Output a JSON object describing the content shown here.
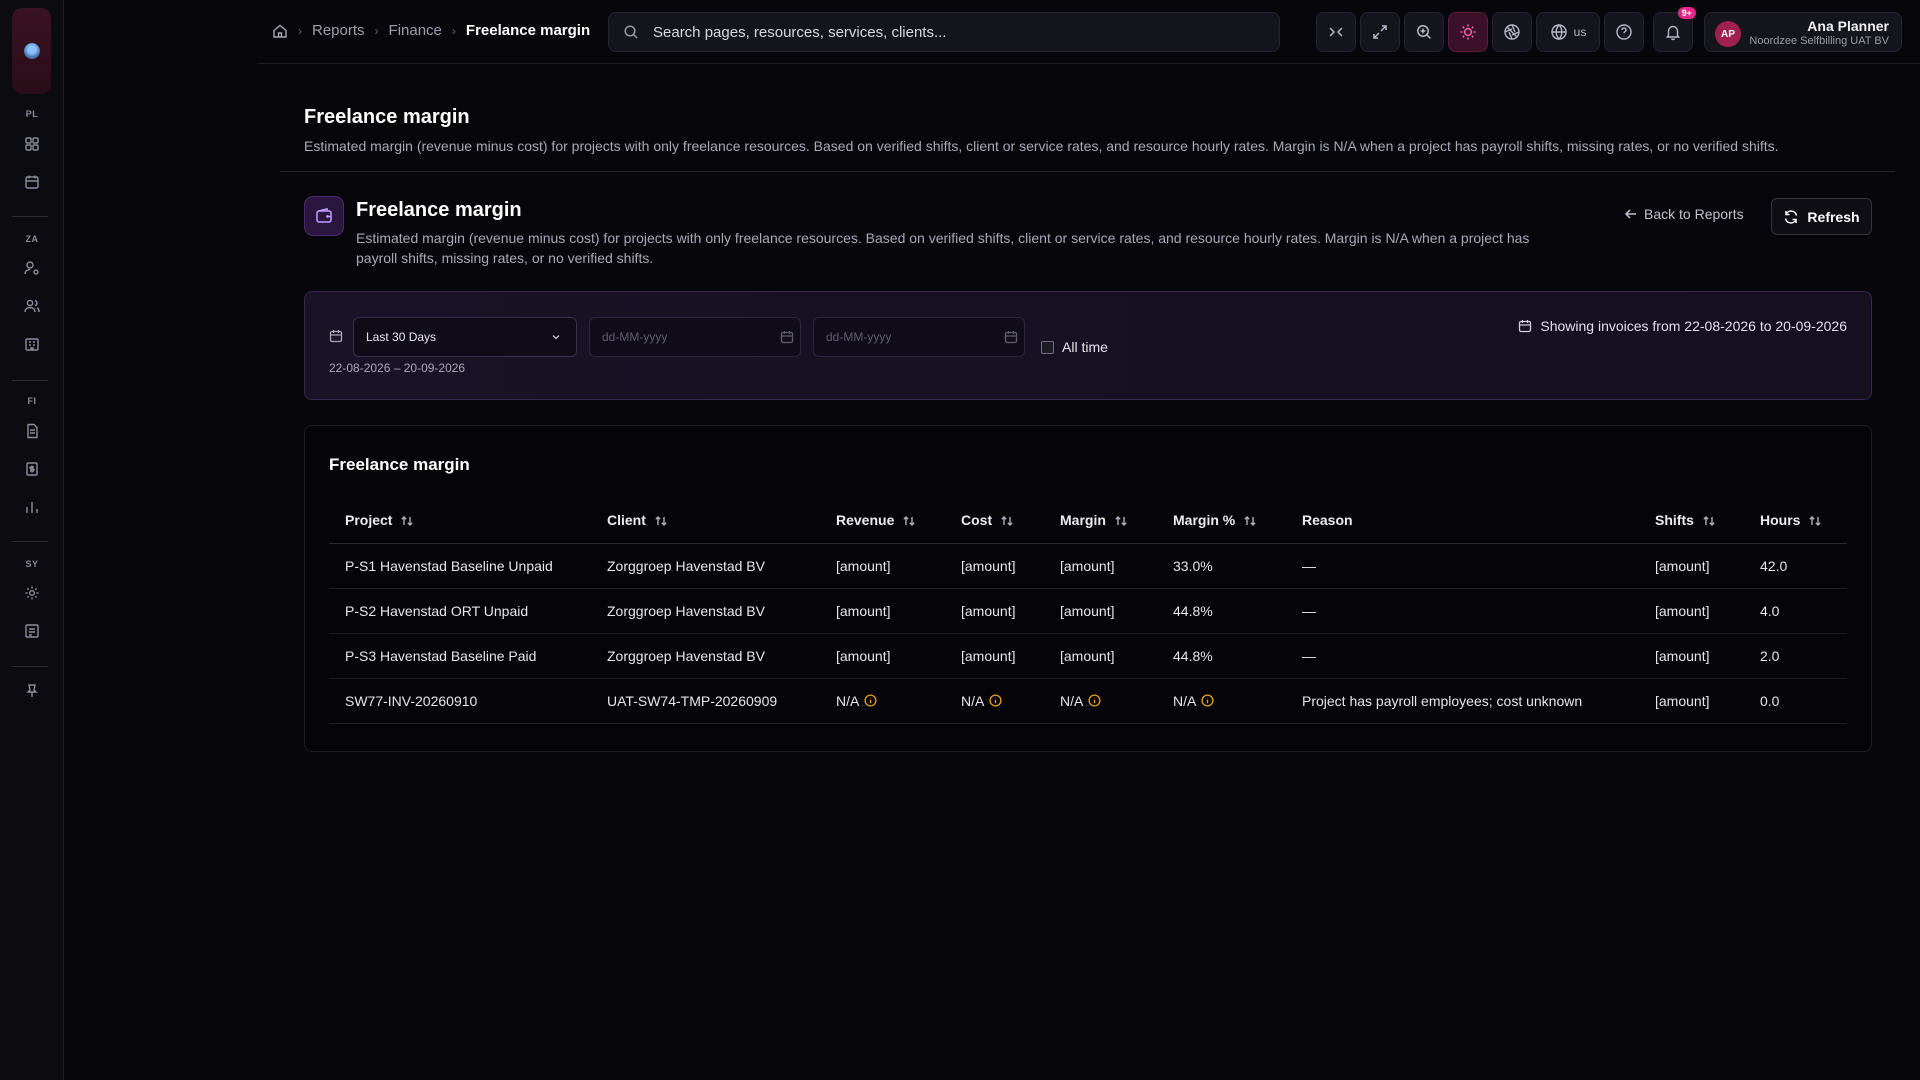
{
  "sidebar": {
    "sections": [
      "PL",
      "ZA",
      "FI",
      "SY"
    ],
    "icons": [
      "dashboard-icon",
      "calendar-icon",
      "user-gear-icon",
      "users-icon",
      "building-icon",
      "document-icon",
      "invoice-icon",
      "bar-chart-icon",
      "settings-icon",
      "receipt-icon",
      "pin-icon"
    ]
  },
  "breadcrumb": {
    "items": [
      "Reports",
      "Finance"
    ],
    "current": "Freelance margin"
  },
  "search": {
    "placeholder": "Search pages, resources, services, clients..."
  },
  "toolbar": {
    "locale": "us",
    "notifications_badge": "9+",
    "active_color": "#ff5fb0"
  },
  "user": {
    "initials": "AP",
    "name": "Ana Planner",
    "org": "Noordzee Selfbilling UAT BV"
  },
  "page": {
    "title": "Freelance margin",
    "description": "Estimated margin (revenue minus cost) for projects with only freelance resources. Based on verified shifts, client or service rates, and resource hourly rates. Margin is N/A when a project has payroll shifts, missing rates, or no verified shifts."
  },
  "card": {
    "title": "Freelance margin",
    "description": "Estimated margin (revenue minus cost) for projects with only freelance resources. Based on verified shifts, client or service rates, and resource hourly rates. Margin is N/A when a project has payroll shifts, missing rates, or no verified shifts.",
    "back_label": "Back to Reports",
    "refresh_label": "Refresh",
    "accent": "#c79bff"
  },
  "filter": {
    "period_selected": "Last 30 Days",
    "from_placeholder": "dd-MM-yyyy",
    "to_placeholder": "dd-MM-yyyy",
    "all_time_label": "All time",
    "all_time_checked": false,
    "range_text": "22-08-2026 – 20-09-2026",
    "showing_text": "Showing invoices from 22-08-2026 to 20-09-2026"
  },
  "table": {
    "title": "Freelance margin",
    "columns": [
      "Project",
      "Client",
      "Revenue",
      "Cost",
      "Margin",
      "Margin %",
      "Reason",
      "Shifts",
      "Hours"
    ],
    "sortable": [
      true,
      true,
      true,
      true,
      true,
      true,
      false,
      true,
      true
    ],
    "rows": [
      {
        "project": "P-S1 Havenstad Baseline Unpaid",
        "client": "Zorggroep Havenstad BV",
        "revenue": "[amount]",
        "cost": "[amount]",
        "margin": "[amount]",
        "margin_pct": "33.0%",
        "reason": "—",
        "shifts": "[amount]",
        "hours": "42.0"
      },
      {
        "project": "P-S2 Havenstad ORT Unpaid",
        "client": "Zorggroep Havenstad BV",
        "revenue": "[amount]",
        "cost": "[amount]",
        "margin": "[amount]",
        "margin_pct": "44.8%",
        "reason": "—",
        "shifts": "[amount]",
        "hours": "4.0"
      },
      {
        "project": "P-S3 Havenstad Baseline Paid",
        "client": "Zorggroep Havenstad BV",
        "revenue": "[amount]",
        "cost": "[amount]",
        "margin": "[amount]",
        "margin_pct": "44.8%",
        "reason": "—",
        "shifts": "[amount]",
        "hours": "2.0"
      },
      {
        "project": "SW77-INV-20260910",
        "client": "UAT-SW74-TMP-20260909",
        "revenue": "N/A",
        "cost": "N/A",
        "margin": "N/A",
        "margin_pct": "N/A",
        "reason": "Project has payroll employees; cost unknown",
        "shifts": "[amount]",
        "hours": "0.0",
        "na": true
      }
    ],
    "warning_color": "#e8a21a"
  }
}
